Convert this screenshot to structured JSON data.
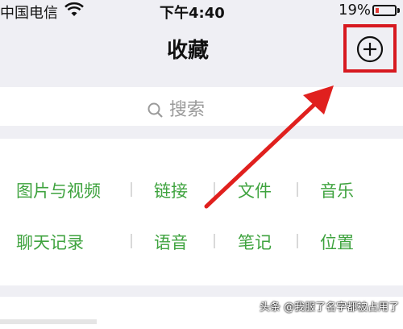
{
  "status_bar": {
    "carrier": "中国电信",
    "time": "下午4:40",
    "battery_percent": "19%",
    "battery_level": 0.19,
    "wifi_icon": "wifi-icon"
  },
  "nav": {
    "title": "收藏",
    "add_icon": "plus-circle-icon"
  },
  "search": {
    "placeholder": "搜索",
    "icon": "search-icon"
  },
  "categories": {
    "row1": [
      "图片与视频",
      "链接",
      "文件",
      "音乐"
    ],
    "row2": [
      "聊天记录",
      "语音",
      "笔记",
      "位置"
    ]
  },
  "watermark": "头条 @我服了名字都被占用了",
  "colors": {
    "accent_green": "#3fa33f",
    "highlight_red": "#d71920",
    "background": "#efeff4"
  }
}
